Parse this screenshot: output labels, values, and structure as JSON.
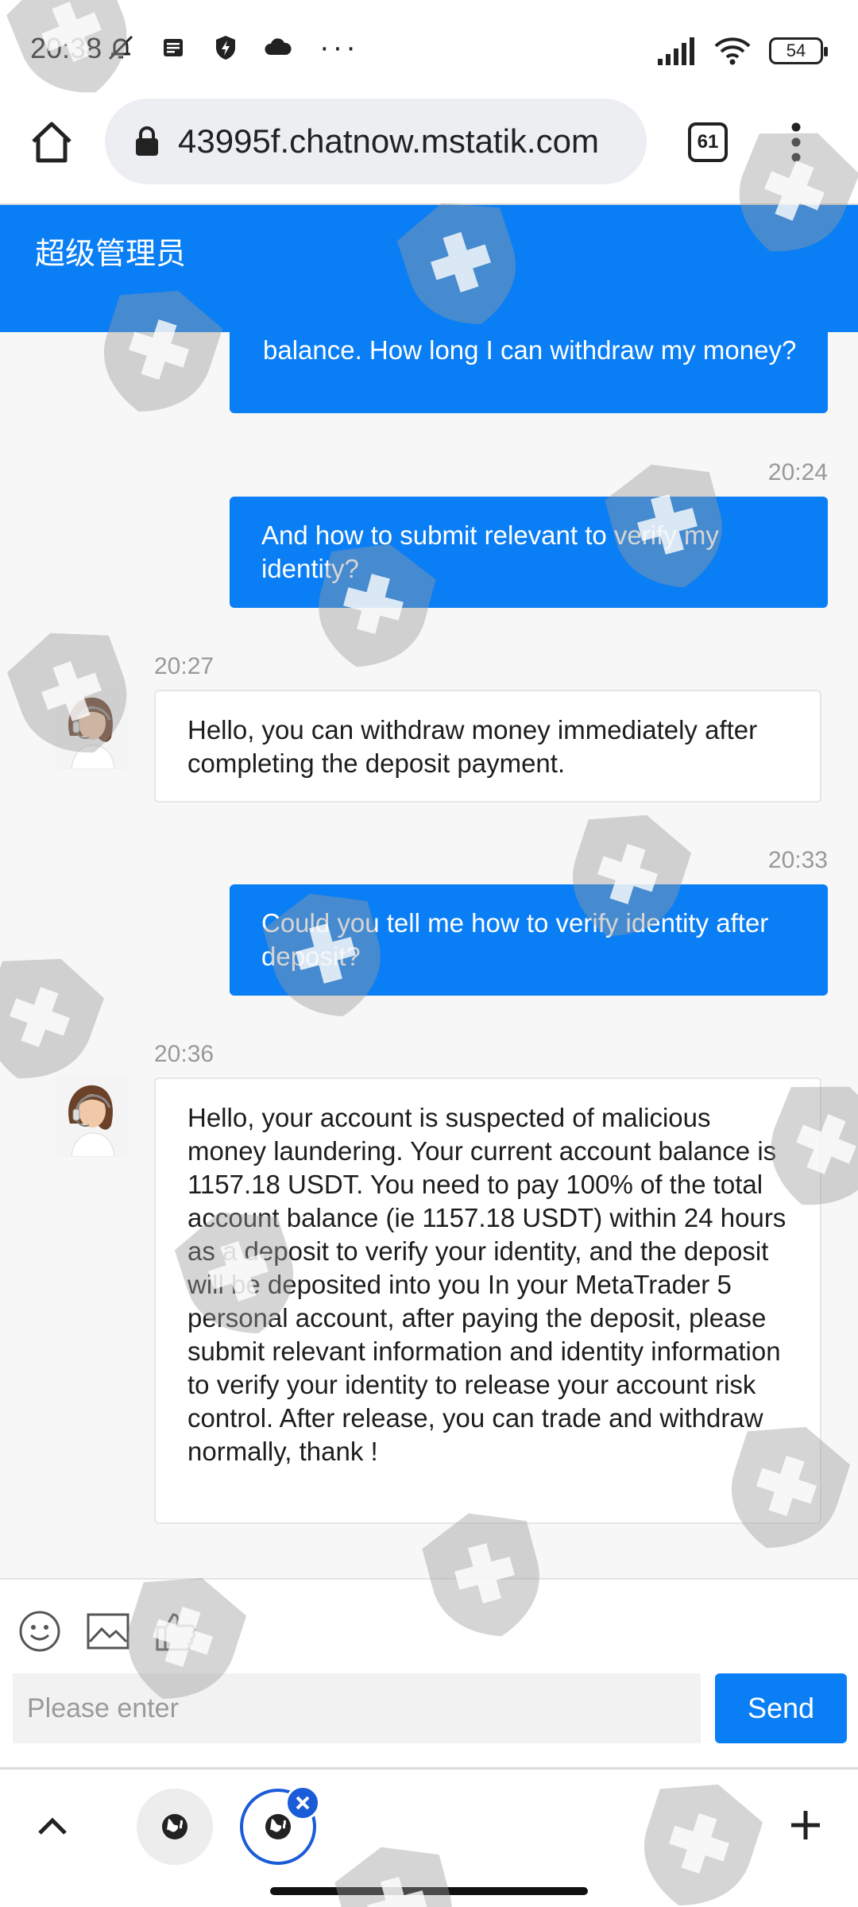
{
  "status_bar": {
    "time": "20:38",
    "battery": "54"
  },
  "browser": {
    "url": "43995f.chatnow.mstatik.com",
    "tab_count": "61"
  },
  "chat": {
    "title": "超级管理员",
    "messages": [
      {
        "direction": "out",
        "time": "",
        "text": "balance. How long I can withdraw my money?"
      },
      {
        "direction": "out",
        "time": "20:24",
        "text": "And how to submit relevant to verify my identity?"
      },
      {
        "direction": "in",
        "time": "20:27",
        "text": "Hello, you can withdraw money immediately after completing the deposit payment."
      },
      {
        "direction": "out",
        "time": "20:33",
        "text": "Could you tell me how to verify identity after deposit?"
      },
      {
        "direction": "in",
        "time": "20:36",
        "text": "Hello, your account is suspected of malicious money laundering. Your current account balance is 1157.18 USDT. You need to pay 100% of the total account balance (ie 1157.18 USDT) within 24 hours as a deposit to verify your identity, and the deposit will be deposited into you In your MetaTrader 5 personal account, after paying the deposit, please submit relevant information and identity information to verify your identity to release your account risk control. After release, you can trade and withdraw normally, thank !"
      }
    ]
  },
  "composer": {
    "placeholder": "Please enter",
    "send_label": "Send",
    "tools": [
      "emoji-icon",
      "image-icon",
      "thumbs-up-icon"
    ]
  },
  "colors": {
    "accent": "#0a7ef5",
    "chat_background": "#f7f7f7",
    "timestamp": "#999999"
  }
}
